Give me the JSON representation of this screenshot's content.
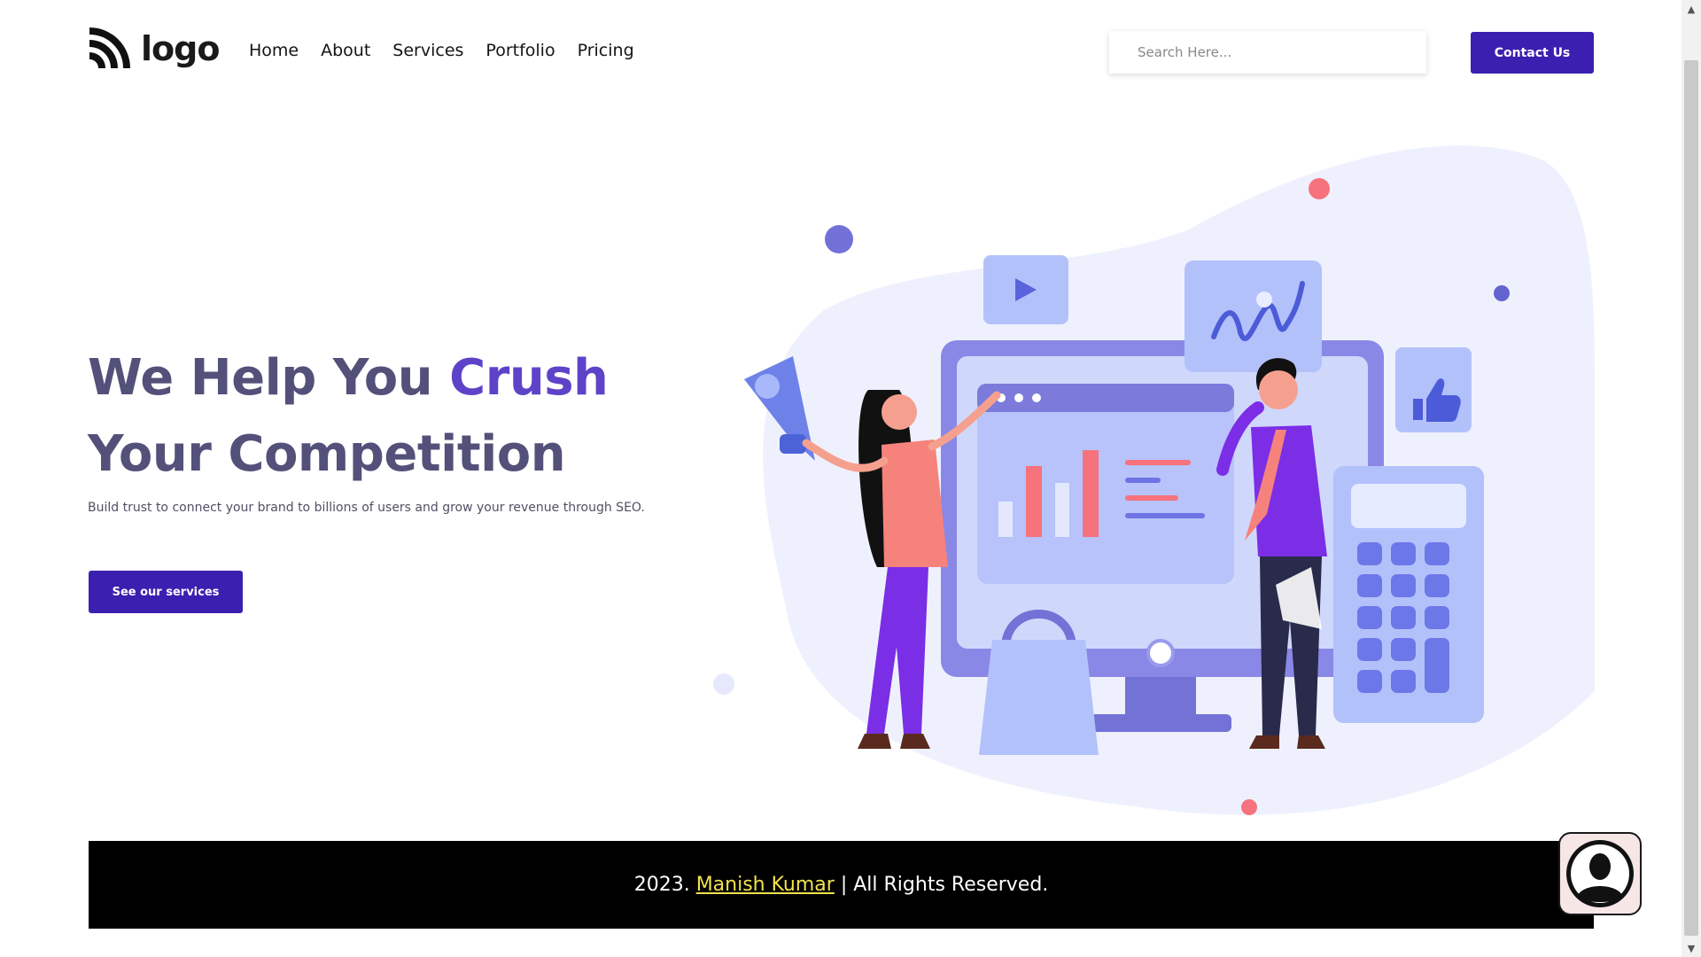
{
  "header": {
    "logo_text": "logo",
    "nav": [
      "Home",
      "About",
      "Services",
      "Portfolio",
      "Pricing"
    ],
    "search_placeholder": "Search Here...",
    "contact_label": "Contact Us"
  },
  "hero": {
    "title_part1": "We Help You ",
    "title_accent": "Crush",
    "title_part2": " Your Competition",
    "subtitle": "Build trust to connect your brand to billions of users and grow your revenue through SEO.",
    "cta_label": "See our services"
  },
  "footer": {
    "year": "2023.",
    "author": "Manish Kumar",
    "rights": "| All Rights Reserved."
  },
  "colors": {
    "accent": "#3b1fb0",
    "title": "#53507a",
    "title_accent": "#5e43c9",
    "footer_bg": "#000000",
    "footer_link": "#f2e14c"
  }
}
